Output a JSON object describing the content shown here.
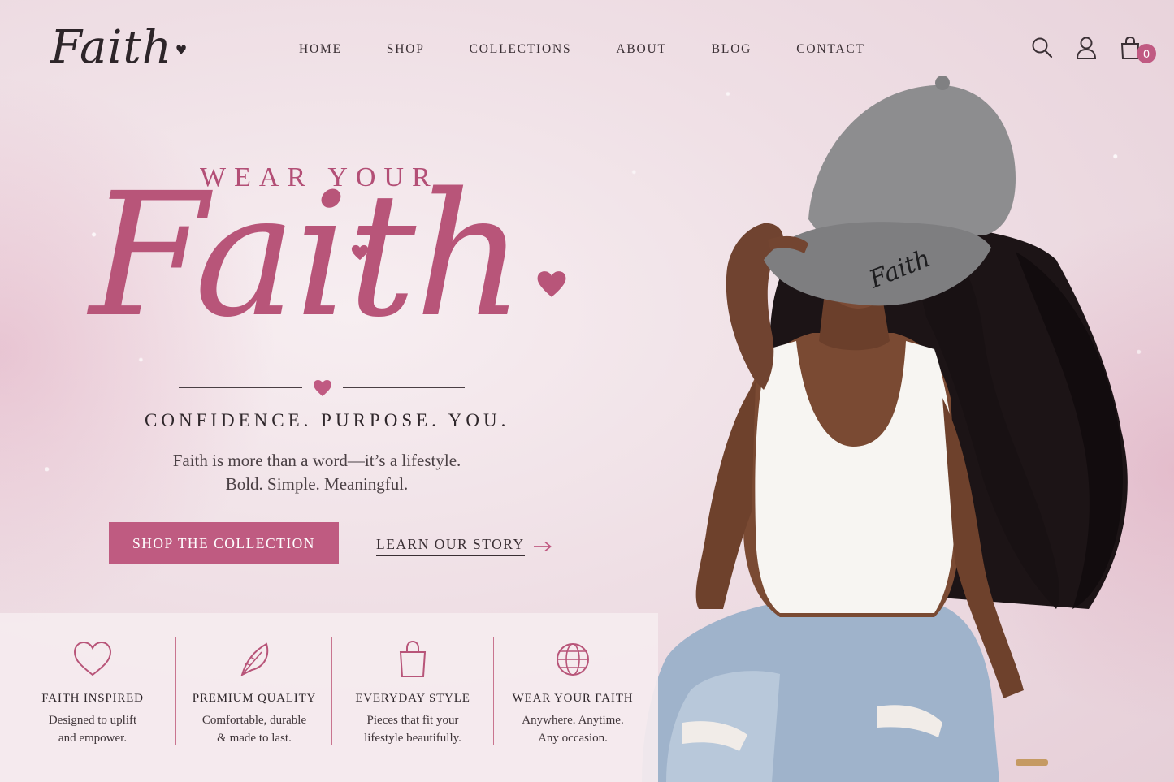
{
  "brand": {
    "logo_text": "Faith"
  },
  "nav": [
    {
      "label": "HOME"
    },
    {
      "label": "SHOP"
    },
    {
      "label": "COLLECTIONS"
    },
    {
      "label": "ABOUT"
    },
    {
      "label": "BLOG"
    },
    {
      "label": "CONTACT"
    }
  ],
  "header_icons": {
    "search": "search-icon",
    "account": "user-icon",
    "cart": "shopping-bag-icon",
    "cart_count": "0"
  },
  "hero": {
    "eyebrow": "WEAR YOUR",
    "title": "Faith",
    "tagline": "CONFIDENCE. PURPOSE. YOU.",
    "description_line1": "Faith is more than a word—it’s a lifestyle.",
    "description_line2": "Bold. Simple. Meaningful.",
    "primary_cta": "SHOP THE COLLECTION",
    "secondary_cta": "LEARN OUR STORY"
  },
  "features": [
    {
      "icon": "heart-icon",
      "title": "FAITH INSPIRED",
      "line1": "Designed to uplift",
      "line2": "and empower."
    },
    {
      "icon": "feather-icon",
      "title": "PREMIUM QUALITY",
      "line1": "Comfortable, durable",
      "line2": "& made to last."
    },
    {
      "icon": "shopping-bag-icon",
      "title": "EVERYDAY STYLE",
      "line1": "Pieces that fit your",
      "line2": "lifestyle beautifully."
    },
    {
      "icon": "globe-icon",
      "title": "WEAR YOUR FAITH",
      "line1": "Anywhere. Anytime.",
      "line2": "Any occasion."
    }
  ],
  "model": {
    "cap_text": "Faith"
  },
  "colors": {
    "accent": "#bf5b81",
    "title": "#b85579",
    "text": "#2f272b",
    "background": "#efdfe5"
  }
}
